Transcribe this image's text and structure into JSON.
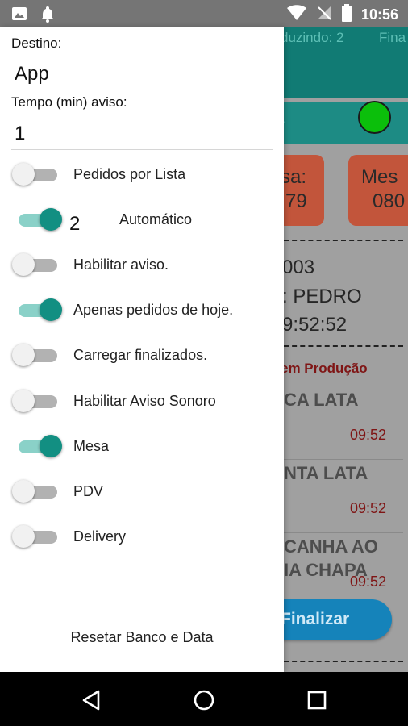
{
  "status_bar": {
    "time": "10:56",
    "icons": [
      "image-icon",
      "notification-bell-icon",
      "wifi-icon",
      "no-signal-icon",
      "battery-icon"
    ]
  },
  "background_app": {
    "header_producing": "duzindo: 2",
    "header_finished": "Fina",
    "cards": [
      {
        "line1": "sa:",
        "line2": "79"
      },
      {
        "line1": "Mes",
        "line2": "080"
      }
    ],
    "order_number": "003",
    "order_customer": ": PEDRO",
    "order_time": "9:52:52",
    "order_status": "em Produção",
    "items": [
      {
        "name": "CA LATA",
        "time": "09:52"
      },
      {
        "name": "NTA LATA",
        "time": "09:52"
      },
      {
        "name_line1": "CANHA AO",
        "name_line2": "IA CHAPA",
        "time": "09:52"
      }
    ],
    "finalize_button": "Finalizar",
    "colors": {
      "teal": "#117b74",
      "card": "#c2553b",
      "status_dot": "#0bbf0b",
      "button": "#1583ba"
    }
  },
  "drawer": {
    "destino_label": "Destino:",
    "destino_value": "App",
    "tempo_label": "Tempo (min) aviso:",
    "tempo_value": "1",
    "auto_number": "2",
    "auto_label": "Automático",
    "options": [
      {
        "label": "Pedidos por Lista",
        "on": false
      },
      {
        "label": "",
        "on": true
      },
      {
        "label": "Habilitar aviso.",
        "on": false
      },
      {
        "label": "Apenas pedidos de hoje.",
        "on": true
      },
      {
        "label": "Carregar finalizados.",
        "on": false
      },
      {
        "label": "Habilitar Aviso Sonoro",
        "on": false
      },
      {
        "label": "Mesa",
        "on": true
      },
      {
        "label": "PDV",
        "on": false
      },
      {
        "label": "Delivery",
        "on": false
      }
    ],
    "reset_button": "Resetar Banco e Data",
    "accent_color": "#128f82"
  },
  "nav_bar": {
    "buttons": [
      "back-icon",
      "home-icon",
      "recents-icon"
    ]
  }
}
